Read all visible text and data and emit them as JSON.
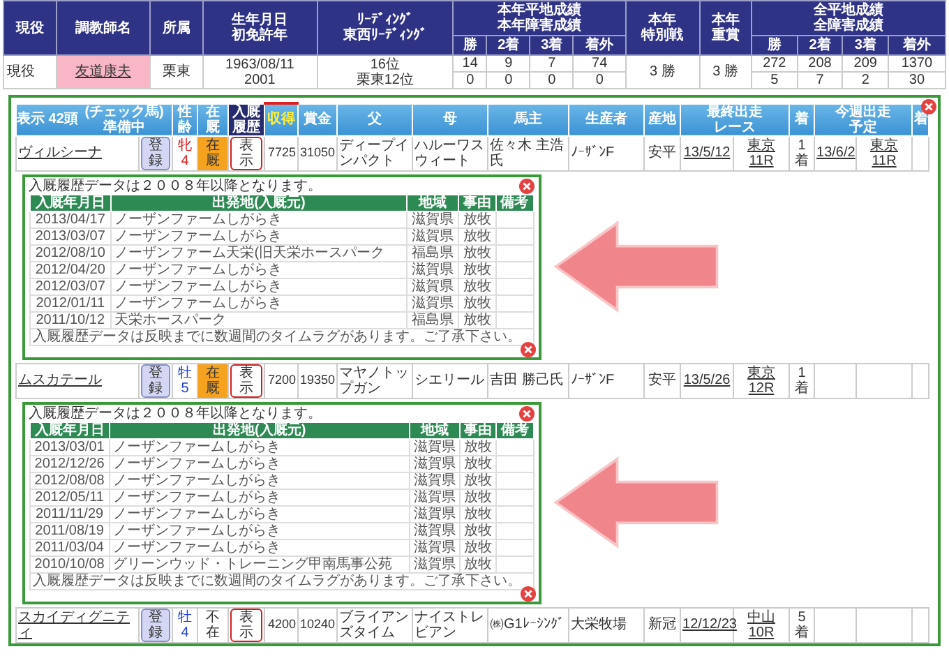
{
  "trainer_table": {
    "columns": [
      {
        "lines": [
          "現役"
        ]
      },
      {
        "lines": [
          "調教師名"
        ]
      },
      {
        "lines": [
          "所属"
        ]
      },
      {
        "lines": [
          "生年月日",
          "初免許年"
        ]
      },
      {
        "lines": [
          "ﾘｰﾃﾞｨﾝｸﾞ",
          "東西ﾘｰﾃﾞｨﾝｸﾞ"
        ]
      },
      {
        "lines": [
          "本年平地成績",
          "本年障害成績"
        ],
        "sub": [
          "勝",
          "2着",
          "3着",
          "着外"
        ]
      },
      {
        "lines": [
          "本年",
          "特別戦"
        ]
      },
      {
        "lines": [
          "本年",
          "重賞"
        ]
      },
      {
        "lines": [
          "全平地成績",
          "全障害成績"
        ],
        "sub": [
          "勝",
          "2着",
          "3着",
          "着外"
        ]
      }
    ],
    "row": {
      "status": "現役",
      "name": "友道康夫",
      "affiliation": "栗東",
      "birth": [
        "1963/08/11",
        "2001"
      ],
      "leading": [
        "16位",
        "栗東12位"
      ],
      "year_record": [
        [
          "14",
          "9",
          "7",
          "74"
        ],
        [
          "0",
          "0",
          "0",
          "0"
        ]
      ],
      "special": "3 勝",
      "graded": "3 勝",
      "total_record": [
        [
          "272",
          "208",
          "209",
          "1370"
        ],
        [
          "5",
          "7",
          "2",
          "30"
        ]
      ]
    }
  },
  "horse_table": {
    "title": "表示 42頭",
    "subtitle": [
      "(チェック馬)",
      "準備中"
    ],
    "columns": [
      {
        "lines": [
          "性齢"
        ],
        "kind": "plain"
      },
      {
        "lines": [
          "在厩"
        ],
        "kind": "plain"
      },
      {
        "lines": [
          "入厩",
          "履歴"
        ],
        "kind": "dark"
      },
      {
        "lines": [
          "収得"
        ],
        "kind": "highlight"
      },
      {
        "lines": [
          "賞金"
        ],
        "kind": "plain"
      },
      {
        "lines": [
          "父"
        ],
        "kind": "plain"
      },
      {
        "lines": [
          "母"
        ],
        "kind": "plain"
      },
      {
        "lines": [
          "馬主"
        ],
        "kind": "plain"
      },
      {
        "lines": [
          "生産者"
        ],
        "kind": "plain"
      },
      {
        "lines": [
          "産地"
        ],
        "kind": "plain"
      },
      {
        "lines": [
          "最終出走",
          "レース"
        ],
        "kind": "group"
      },
      {
        "lines": [
          "着"
        ],
        "kind": "plain"
      },
      {
        "lines": [
          "今週出走",
          "予定"
        ],
        "kind": "group"
      },
      {
        "lines": [
          "着"
        ],
        "kind": "plain"
      }
    ],
    "horses": [
      {
        "name": "ヴィルシーナ",
        "register": "登録",
        "sex": {
          "text": "牝4",
          "color": "#e02020"
        },
        "stable": {
          "text": "在厩",
          "in_stable": true
        },
        "history_button": "表示",
        "earnings": "7725",
        "prize": "31050",
        "sire": "ディープインパクト",
        "dam": "ハルーワスウィート",
        "owner": "佐々木 主浩氏",
        "breeder": "ﾉｰｻﾞﾝF",
        "area": "安平",
        "last_date": "13/5/12",
        "last_race": "東京11R",
        "finish": "1着",
        "next_date": "13/6/2",
        "next_race": "東京11R",
        "history": {
          "note": "入厩履歴データは２００８年以降となります。",
          "columns": [
            "入厩年月日",
            "出発地(入厩元)",
            "地域",
            "事由",
            "備考"
          ],
          "rows": [
            [
              "2013/04/17",
              "ノーザンファームしがらき",
              "滋賀県",
              "放牧"
            ],
            [
              "2013/03/07",
              "ノーザンファームしがらき",
              "滋賀県",
              "放牧"
            ],
            [
              "2012/08/10",
              "ノーザンファーム天栄(旧天栄ホースパーク",
              "福島県",
              "放牧"
            ],
            [
              "2012/04/20",
              "ノーザンファームしがらき",
              "滋賀県",
              "放牧"
            ],
            [
              "2012/03/07",
              "ノーザンファームしがらき",
              "滋賀県",
              "放牧"
            ],
            [
              "2012/01/11",
              "ノーザンファームしがらき",
              "滋賀県",
              "放牧"
            ],
            [
              "2011/10/12",
              "天栄ホースパーク",
              "福島県",
              "放牧"
            ]
          ],
          "footer": "入厩履歴データは反映までに数週間のタイムラグがあります。ご了承下さい。"
        }
      },
      {
        "name": "ムスカテール",
        "register": "登録",
        "sex": {
          "text": "牡5",
          "color": "#2040e0"
        },
        "stable": {
          "text": "在厩",
          "in_stable": true
        },
        "history_button": "表示",
        "earnings": "7200",
        "prize": "19350",
        "sire": "マヤノトップガン",
        "dam": "シエリール",
        "owner": "吉田 勝己氏",
        "breeder": "ﾉｰｻﾞﾝF",
        "area": "安平",
        "last_date": "13/5/26",
        "last_race": "東京12R",
        "finish": "1着",
        "history": {
          "note": "入厩履歴データは２００８年以降となります。",
          "columns": [
            "入厩年月日",
            "出発地(入厩元)",
            "地域",
            "事由",
            "備考"
          ],
          "rows": [
            [
              "2013/03/01",
              "ノーザンファームしがらき",
              "滋賀県",
              "放牧"
            ],
            [
              "2012/12/26",
              "ノーザンファームしがらき",
              "滋賀県",
              "放牧"
            ],
            [
              "2012/08/08",
              "ノーザンファームしがらき",
              "滋賀県",
              "放牧"
            ],
            [
              "2012/05/11",
              "ノーザンファームしがらき",
              "滋賀県",
              "放牧"
            ],
            [
              "2011/11/29",
              "ノーザンファームしがらき",
              "滋賀県",
              "放牧"
            ],
            [
              "2011/08/19",
              "ノーザンファームしがらき",
              "滋賀県",
              "放牧"
            ],
            [
              "2011/03/04",
              "ノーザンファームしがらき",
              "滋賀県",
              "放牧"
            ],
            [
              "2010/10/08",
              "グリーンウッド・トレーニング甲南馬事公苑",
              "滋賀県",
              "放牧"
            ]
          ],
          "footer": "入厩履歴データは反映までに数週間のタイムラグがあります。ご了承下さい。"
        }
      },
      {
        "name": "スカイディグニティ",
        "register": "登録",
        "sex": {
          "text": "牡4",
          "color": "#2040e0"
        },
        "stable": {
          "text": "不在",
          "in_stable": false
        },
        "history_button": "表示",
        "earnings": "4200",
        "prize": "10240",
        "sire": "ブライアンズタイム",
        "dam": "ナイストレビアン",
        "owner": "㈱G1ﾚｰｼﾝｸﾞ",
        "breeder": "大栄牧場",
        "area": "新冠",
        "last_date": "12/12/23",
        "last_race": "中山10R",
        "finish": "5着"
      }
    ]
  }
}
